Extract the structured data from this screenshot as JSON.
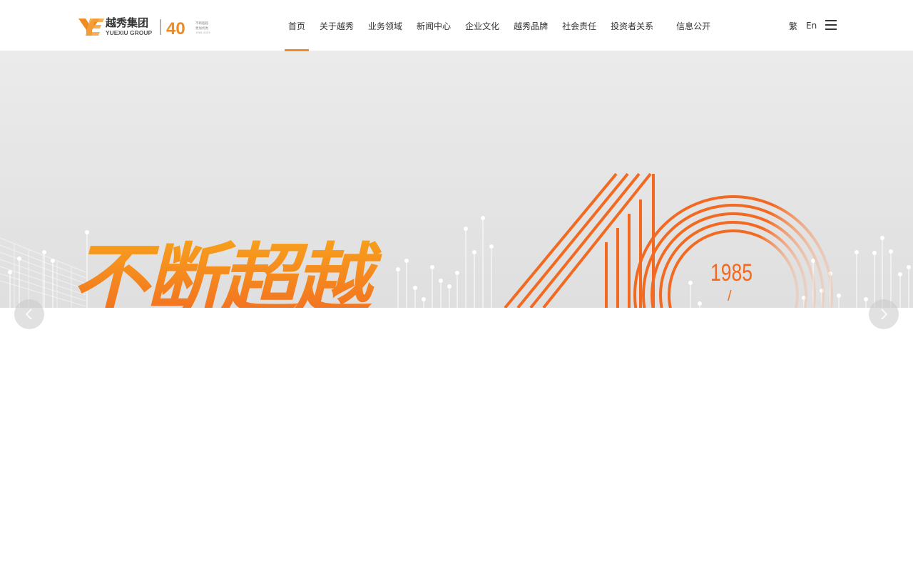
{
  "header": {
    "logo": {
      "brand_cn": "越秀集团",
      "brand_en": "YUEXIU GROUP",
      "anniversary": "40",
      "badge_line1": "不断超越",
      "badge_line2": "更加优秀",
      "badge_years": "1985-2025"
    },
    "nav": [
      {
        "label": "首页",
        "active": true
      },
      {
        "label": "关于越秀",
        "active": false
      },
      {
        "label": "业务领域",
        "active": false
      },
      {
        "label": "新闻中心",
        "active": false
      },
      {
        "label": "企业文化",
        "active": false
      },
      {
        "label": "越秀品牌",
        "active": false
      },
      {
        "label": "社会责任",
        "active": false
      },
      {
        "label": "投资者关系",
        "active": false
      },
      {
        "label": "信息公开",
        "active": false
      }
    ],
    "lang_traditional": "繁",
    "lang_english": "En",
    "menu_icon": "hamburger-icon"
  },
  "hero": {
    "slogan": "不断超越",
    "year": "1985",
    "year_separator": "/"
  },
  "carousel": {
    "prev_icon": "chevron-left-icon",
    "next_icon": "chevron-right-icon"
  },
  "colors": {
    "accent": "#f08a24",
    "orange_deep": "#f26a21",
    "text": "#333333",
    "hero_bg": "#e3e3e3"
  }
}
